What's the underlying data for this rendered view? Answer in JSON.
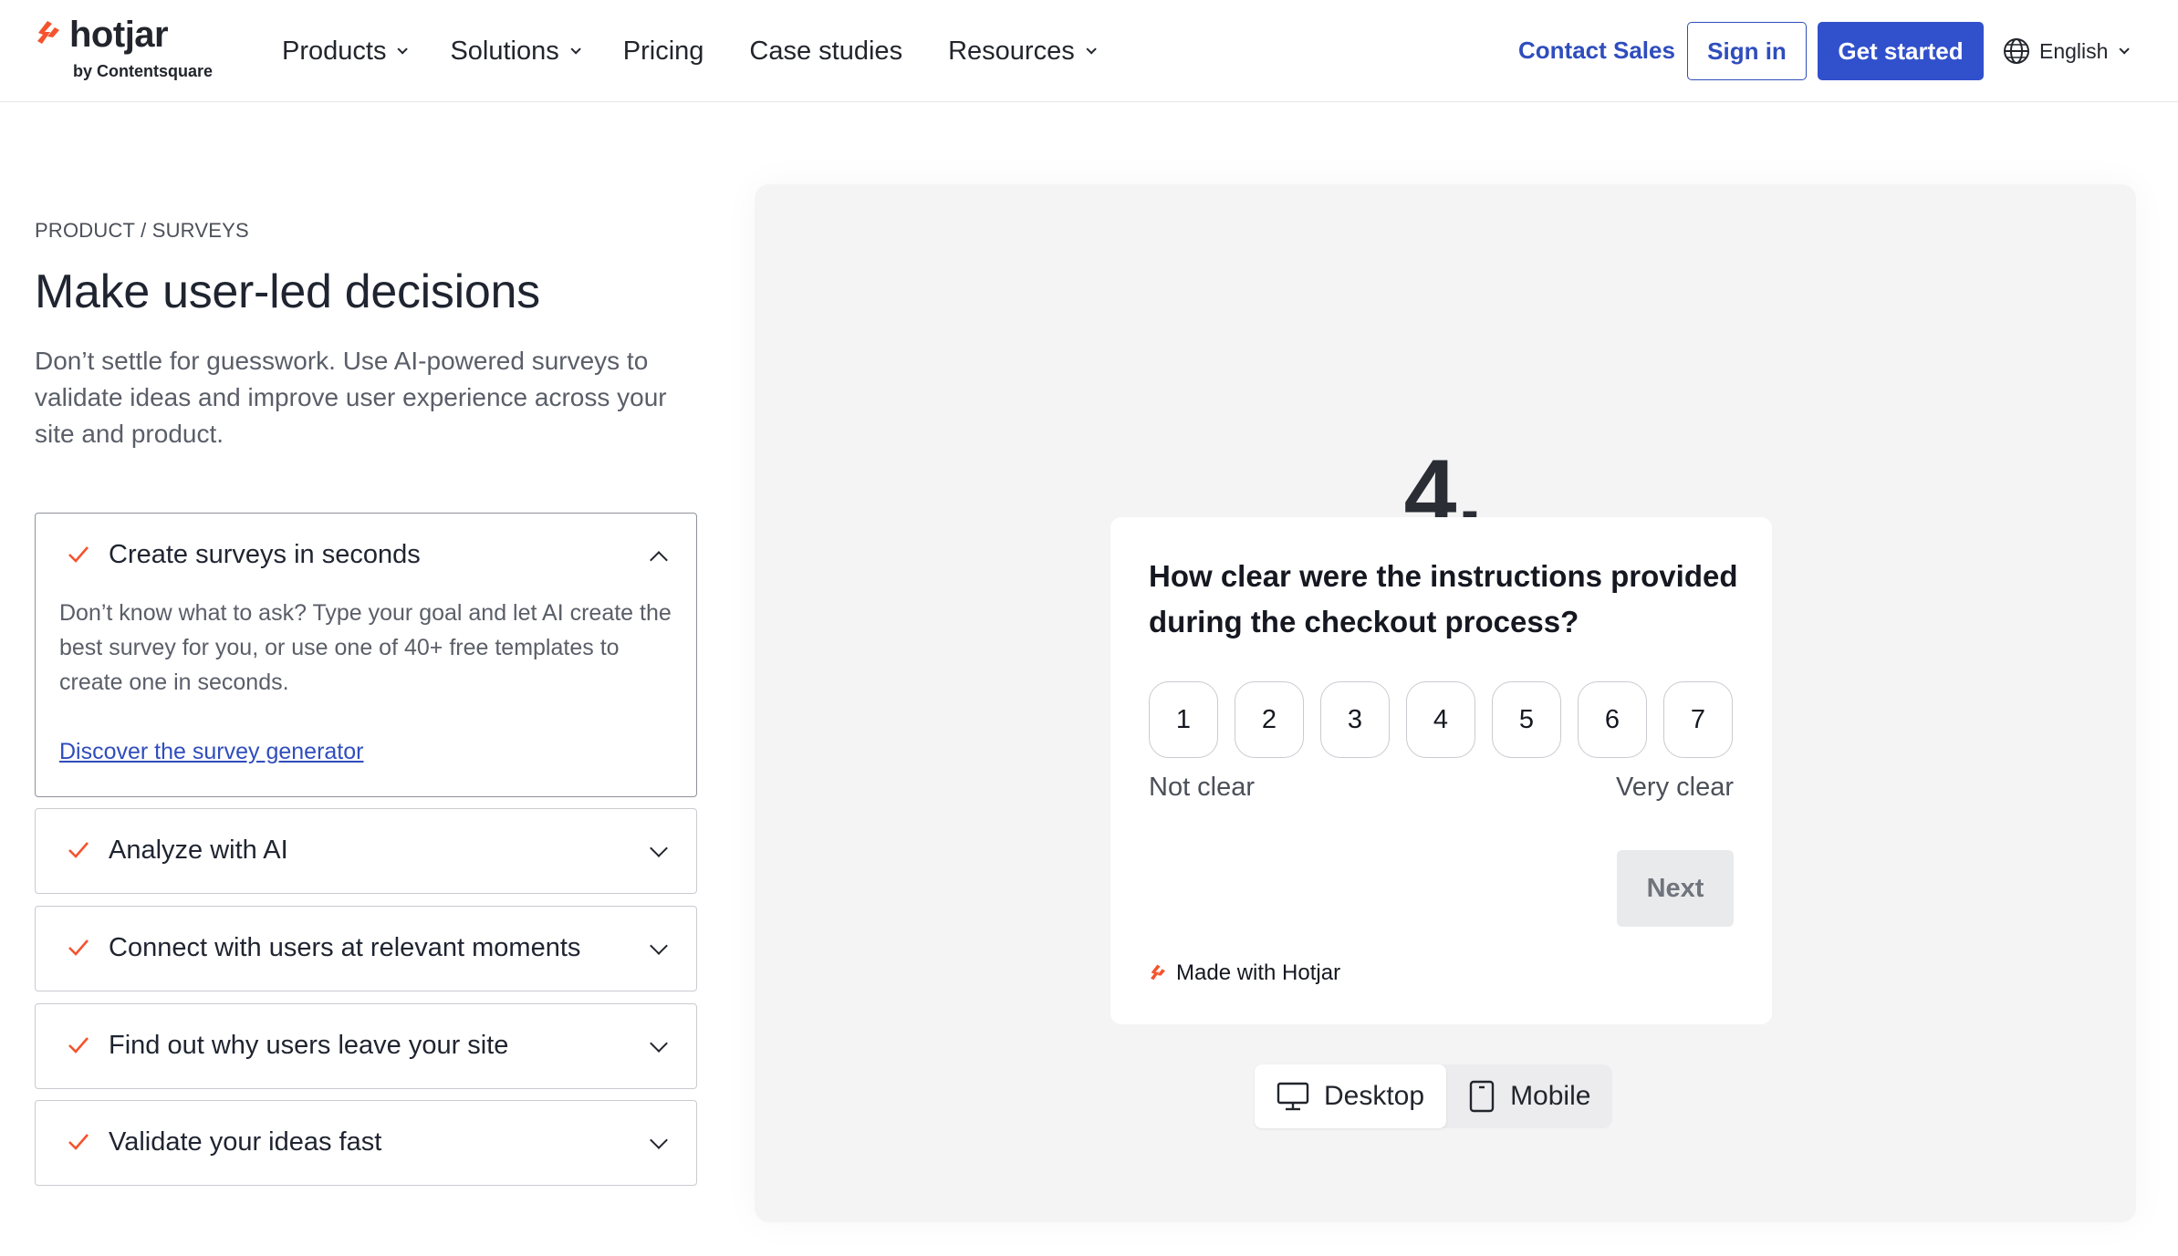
{
  "brand": {
    "name": "hotjar",
    "sub": "by Contentsquare",
    "accent": "#f4532e",
    "primary": "#3150cc"
  },
  "nav": {
    "items": [
      {
        "label": "Products",
        "dropdown": true
      },
      {
        "label": "Solutions",
        "dropdown": true
      },
      {
        "label": "Pricing",
        "dropdown": false
      },
      {
        "label": "Case studies",
        "dropdown": false
      },
      {
        "label": "Resources",
        "dropdown": true
      }
    ],
    "contact_sales": "Contact Sales",
    "sign_in": "Sign in",
    "get_started": "Get started",
    "language": "English"
  },
  "hero": {
    "breadcrumb": "PRODUCT / SURVEYS",
    "title": "Make user-led decisions",
    "intro": "Don’t settle for guesswork. Use AI-powered surveys to validate ideas and improve user experience across your site and product."
  },
  "features": [
    {
      "title": "Create surveys in seconds",
      "expanded": true,
      "body": "Don’t know what to ask? Type your goal and let AI create the best survey for you, or use one of 40+ free templates to create one in seconds.",
      "link": "Discover the survey generator"
    },
    {
      "title": "Analyze with AI",
      "expanded": false
    },
    {
      "title": "Connect with users at relevant moments",
      "expanded": false
    },
    {
      "title": "Find out why users leave your site",
      "expanded": false
    },
    {
      "title": "Validate your ideas fast",
      "expanded": false
    }
  ],
  "demo": {
    "step": "4.",
    "question": "How clear were the instructions provided during the checkout process?",
    "scale": [
      "1",
      "2",
      "3",
      "4",
      "5",
      "6",
      "7"
    ],
    "label_low": "Not clear",
    "label_high": "Very clear",
    "next": "Next",
    "made_with": "Made with Hotjar",
    "devices": [
      {
        "label": "Desktop",
        "icon": "desktop-icon",
        "active": true
      },
      {
        "label": "Mobile",
        "icon": "mobile-icon",
        "active": false
      }
    ]
  }
}
